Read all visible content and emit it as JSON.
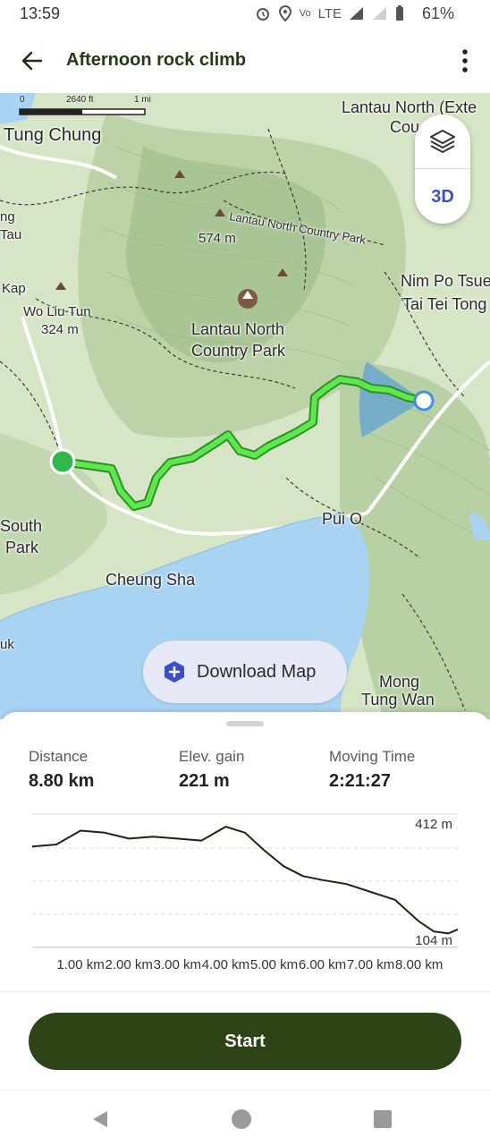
{
  "status_bar": {
    "time": "13:59",
    "network": "LTE",
    "battery": "61%"
  },
  "app_bar": {
    "title": "Afternoon rock climb"
  },
  "map": {
    "scale": {
      "left": "0",
      "mid": "2640 ft",
      "right": "1 mi"
    },
    "labels": {
      "tung_chung": "Tung Chung",
      "lantau_north_ext": "Lantau North (Exte",
      "country_trunc": "Cou",
      "ng": "ng",
      "tau": "Tau",
      "kap": "Kap",
      "wo_liu_tun": "Wo Liu Tun",
      "elev_324": "324 m",
      "elev_574": "574 m",
      "lantau_north_path": "Lantau North Country Park",
      "nim_po_tsuen": "Nim Po Tsue",
      "tai_tei_tong": "Tai Tei Tong",
      "park_line1": "Lantau North",
      "park_line2": "Country Park",
      "south": "South",
      "park_left": "Park",
      "pui_o": "Pui O",
      "cheung_sha": "Cheung Sha",
      "uk": "uk",
      "mong": "Mong",
      "tung_wan": "Tung Wan"
    },
    "btn_3d": "3D",
    "download_label": "Download Map",
    "colors": {
      "track": "#5ee84e",
      "water": "#a9d3f2",
      "terrain": "#cfe0c0",
      "start_dot": "#2fb84c"
    }
  },
  "stats": {
    "distance": {
      "label": "Distance",
      "value": "8.80 km"
    },
    "elev_gain": {
      "label": "Elev. gain",
      "value": "221 m"
    },
    "moving_time": {
      "label": "Moving Time",
      "value": "2:21:27"
    }
  },
  "chart_data": {
    "type": "line",
    "y_max_label": "412 m",
    "y_min_label": "104 m",
    "ylim": [
      104,
      412
    ],
    "x_ticks": [
      "1.00 km",
      "2.00 km",
      "3.00 km",
      "4.00 km",
      "5.00 km",
      "6.00 km",
      "7.00 km",
      "8.00 km"
    ],
    "x": [
      0,
      0.5,
      1.0,
      1.5,
      2.0,
      2.5,
      3.0,
      3.5,
      4.0,
      4.4,
      4.8,
      5.2,
      5.6,
      6.0,
      6.5,
      7.0,
      7.5,
      8.0,
      8.3,
      8.6,
      8.8
    ],
    "y": [
      330,
      335,
      370,
      365,
      350,
      355,
      350,
      345,
      380,
      365,
      320,
      280,
      255,
      245,
      235,
      215,
      195,
      140,
      115,
      110,
      120
    ]
  },
  "start_button": "Start"
}
